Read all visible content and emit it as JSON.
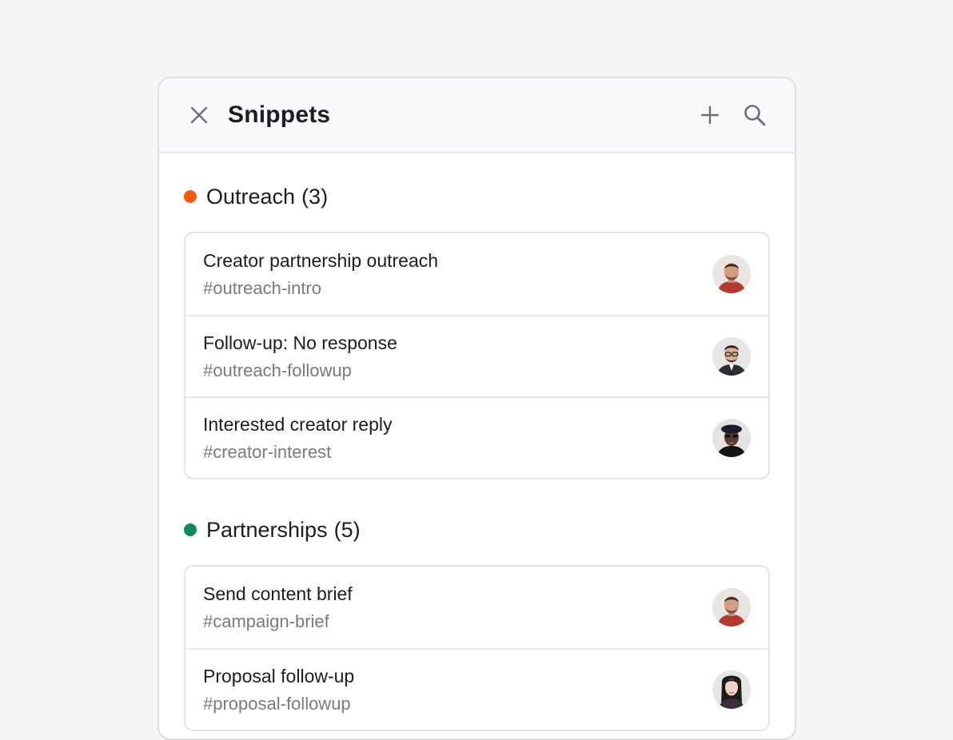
{
  "header": {
    "title": "Snippets",
    "close_icon": "close-icon",
    "add_icon": "plus-icon",
    "search_icon": "search-icon"
  },
  "groups": [
    {
      "name": "Outreach",
      "count": "(3)",
      "color": "#f35b0e",
      "items": [
        {
          "title": "Creator partnership outreach",
          "tag": "#outreach-intro",
          "avatar": "avatar-man-redshirt"
        },
        {
          "title": "Follow-up: No response",
          "tag": "#outreach-followup",
          "avatar": "avatar-man-glasses"
        },
        {
          "title": "Interested creator reply",
          "tag": "#creator-interest",
          "avatar": "avatar-man-beret"
        }
      ]
    },
    {
      "name": "Partnerships",
      "count": "(5)",
      "color": "#0d8a5f",
      "items": [
        {
          "title": "Send content brief",
          "tag": "#campaign-brief",
          "avatar": "avatar-man-redshirt"
        },
        {
          "title": "Proposal follow-up",
          "tag": "#proposal-followup",
          "avatar": "avatar-woman"
        }
      ]
    }
  ]
}
